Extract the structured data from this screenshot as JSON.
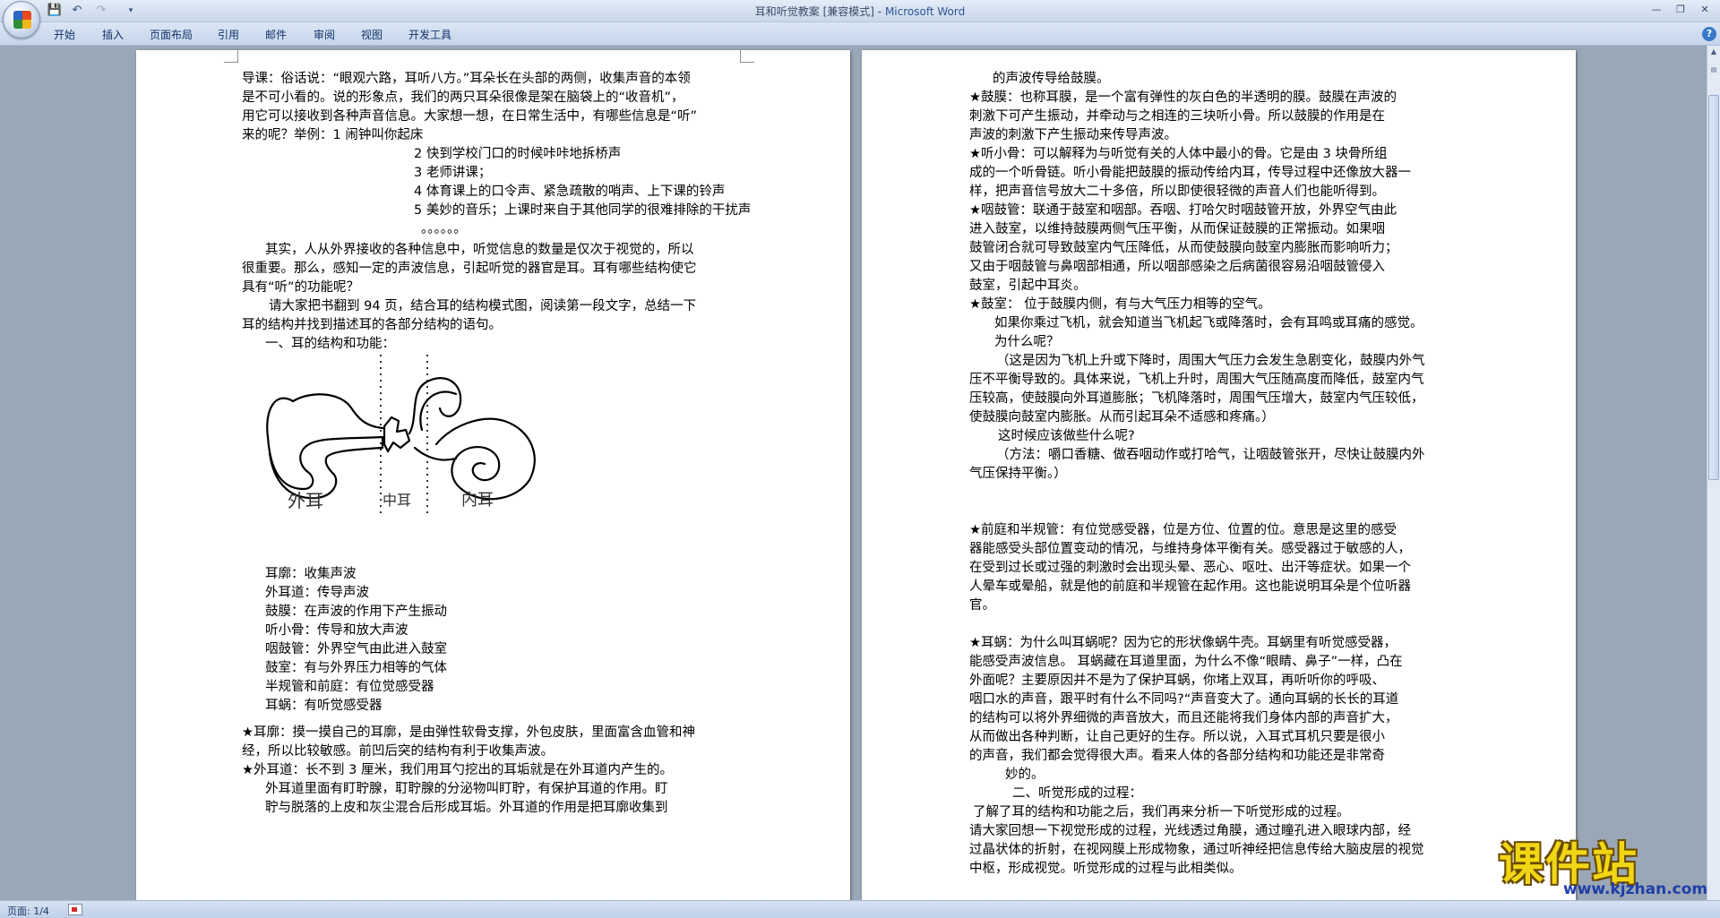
{
  "window": {
    "title": "耳和听觉教案 [兼容模式]",
    "separator": " - ",
    "app": "Microsoft Word",
    "qat": {
      "save": "💾",
      "undo": "↶",
      "redo": "↷",
      "more": "▾"
    },
    "controls": {
      "min": "—",
      "max": "❐",
      "close": "✕"
    }
  },
  "ribbon": {
    "tabs": [
      "开始",
      "插入",
      "页面布局",
      "引用",
      "邮件",
      "审阅",
      "视图",
      "开发工具"
    ],
    "help": "?"
  },
  "page_left": {
    "lines": [
      "导课：俗话说：“眼观六路，耳听八方。”耳朵长在头部的两侧，收集声音的本领",
      "是不可小看的。说的形象点，我们的两只耳朵很像是架在脑袋上的“收音机”，",
      "用它可以接收到各种声音信息。大家想一想，在日常生活中，有哪些信息是“听”",
      "来的呢？举例：1 闹钟叫你起床",
      "2 快到学校门口的时候咔咔地拆桥声",
      "3 老师讲课；",
      "4 体育课上的口令声、紧急疏散的哨声、上下课的铃声",
      "5 美妙的音乐；上课时来自于其他同学的很难排除的干扰声",
      "。。。。。。",
      "其实，人从外界接收的各种信息中，听觉信息的数量是仅次于视觉的，所以",
      "很重要。那么，感知一定的声波信息，引起听觉的器官是耳。耳有哪些结构使它",
      "具有“听”的功能呢？",
      "请大家把书翻到 94 页，结合耳的结构模式图，阅读第一段文字，总结一下",
      "耳的结构并找到描述耳的各部分结构的语句。",
      "一、耳的结构和功能：",
      "耳廓：收集声波",
      "外耳道：传导声波",
      "鼓膜：在声波的作用下产生振动",
      "听小骨：传导和放大声波",
      "咽鼓管：外界空气由此进入鼓室",
      "鼓室：有与外界压力相等的气体",
      "半规管和前庭：有位觉感受器",
      "耳蜗：有听觉感受器",
      "★耳廓：摸一摸自己的耳廓，是由弹性软骨支撑，外包皮肤，里面富含血管和神",
      "经，所以比较敏感。前凹后突的结构有利于收集声波。",
      "★外耳道：长不到 3 厘米，我们用耳勺挖出的耳垢就是在外耳道内产生的。",
      "外耳道里面有盯聍腺，耵聍腺的分泌物叫盯聍，有保护耳道的作用。盯",
      "聍与脱落的上皮和灰尘混合后形成耳垢。外耳道的作用是把耳廓收集到"
    ],
    "figure_labels": [
      "外耳",
      "中耳",
      "内耳"
    ]
  },
  "page_right": {
    "lines": [
      "的声波传导给鼓膜。",
      "★鼓膜：也称耳膜，是一个富有弹性的灰白色的半透明的膜。鼓膜在声波的",
      "刺激下可产生振动，并牵动与之相连的三块听小骨。所以鼓膜的作用是在",
      "声波的刺激下产生振动来传导声波。",
      "★听小骨：可以解释为与听觉有关的人体中最小的骨。它是由 3 块骨所组",
      "成的一个听骨链。听小骨能把鼓膜的振动传给内耳，传导过程中还像放大器一",
      "样，把声音信号放大二十多倍，所以即使很轻微的声音人们也能听得到。",
      "★咽鼓管：联通于鼓室和咽部。吞咽、打哈欠时咽鼓管开放，外界空气由此",
      "进入鼓室，以维持鼓膜两侧气压平衡，从而保证鼓膜的正常振动。如果咽",
      "鼓管闭合就可导致鼓室内气压降低，从而使鼓膜向鼓室内膨胀而影响听力；",
      "又由于咽鼓管与鼻咽部相通，所以咽部感染之后病菌很容易沿咽鼓管侵入",
      "鼓室，引起中耳炎。",
      "★鼓室：  位于鼓膜内侧，有与大气压力相等的空气。",
      "如果你乘过飞机，就会知道当飞机起飞或降落时，会有耳鸣或耳痛的感觉。",
      "为什么呢？",
      "（这是因为飞机上升或下降时，周围大气压力会发生急剧变化，鼓膜内外气",
      "压不平衡导致的。具体来说，飞机上升时，周围大气压随高度而降低，鼓室内气",
      "压较高，使鼓膜向外耳道膨胀；飞机降落时，周围气压增大，鼓室内气压较低，",
      "使鼓膜向鼓室内膨胀。从而引起耳朵不适感和疼痛。）",
      "这时候应该做些什么呢?",
      "（方法：嚼口香糖、做吞咽动作或打哈气，让咽鼓管张开，尽快让鼓膜内外",
      "气压保持平衡。）",
      "",
      "",
      "★前庭和半规管：有位觉感受器，位是方位、位置的位。意思是这里的感受",
      "器能感受头部位置变动的情况，与维持身体平衡有关。感受器过于敏感的人，",
      "在受到过长或过强的刺激时会出现头晕、恶心、呕吐、出汗等症状。如果一个",
      "人晕车或晕船，就是他的前庭和半规管在起作用。这也能说明耳朵是个位听器",
      "官。",
      "",
      "★耳蜗：为什么叫耳蜗呢？因为它的形状像蜗牛壳。耳蜗里有听觉感受器，",
      "能感受声波信息。 耳蜗藏在耳道里面，为什么不像“眼睛、鼻子”一样，凸在",
      "外面呢？主要原因并不是为了保护耳蜗，你堵上双耳，再听听你的呼吸、",
      "咽口水的声音，跟平时有什么不同吗?“声音变大了。通向耳蜗的长长的耳道",
      "的结构可以将外界细微的声音放大，而且还能将我们身体内部的声音扩大，",
      "从而做出各种判断，让自己更好的生存。所以说，入耳式耳机只要是很小",
      "的声音，我们都会觉得很大声。看来人体的各部分结构和功能还是非常奇",
      "妙的。",
      "二、听觉形成的过程：",
      "了解了耳的结构和功能之后，我们再来分析一下听觉形成的过程。",
      "请大家回想一下视觉形成的过程，光线透过角膜，通过瞳孔进入眼球内部，经",
      "过晶状体的折射，在视网膜上形成物象，通过听神经把信息传给大脑皮层的视觉",
      "中枢，形成视觉。听觉形成的过程与此相类似。"
    ]
  },
  "status": {
    "page": "页面: 1/4"
  },
  "watermark": {
    "title": "课件站",
    "url": "www.kjzhan.com"
  },
  "colors": {
    "ribbon": "#c4d5eb",
    "workspace": "#9aa7b6",
    "watermark_fill": "#f1d615",
    "watermark_url": "#1f3ea8"
  }
}
